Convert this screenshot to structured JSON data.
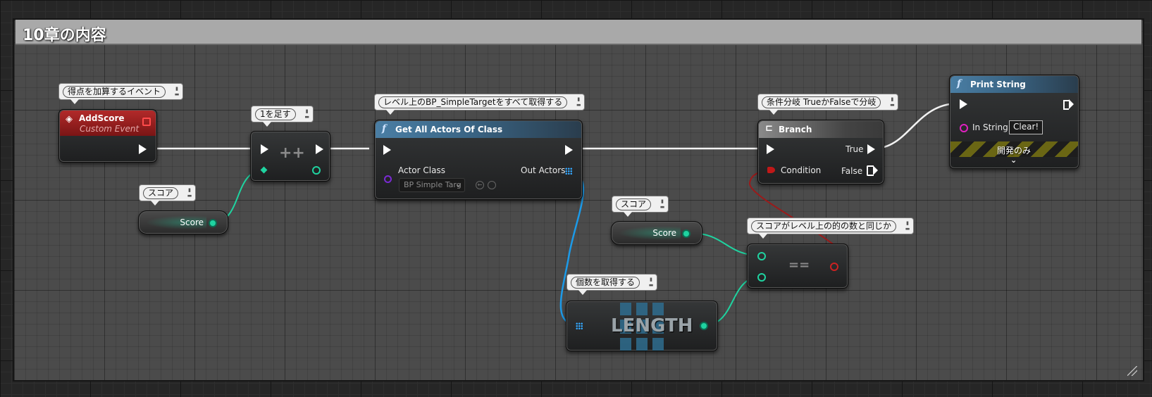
{
  "comment": {
    "title": "10章の内容"
  },
  "bubbles": {
    "add_score": "得点を加算するイベント",
    "increment": "1を足す",
    "get_all": "レベル上のBP_SimpleTargetをすべて取得する",
    "branch": "条件分岐 TrueかFalseで分岐",
    "score1": "スコア",
    "score2": "スコア",
    "equal": "スコアがレベル上の的の数と同じか",
    "length": "個数を取得する"
  },
  "nodes": {
    "add_score": {
      "title": "AddScore",
      "subtitle": "Custom Event"
    },
    "increment": {
      "symbol": "++"
    },
    "get_all": {
      "title": "Get All Actors Of Class",
      "actor_class_label": "Actor Class",
      "actor_class_value": "BP Simple Targ",
      "out_actors_label": "Out Actors"
    },
    "score_var1": {
      "label": "Score"
    },
    "score_var2": {
      "label": "Score"
    },
    "length": {
      "label": "LENGTH"
    },
    "equal": {
      "symbol": "=="
    },
    "branch": {
      "title": "Branch",
      "condition_label": "Condition",
      "true_label": "True",
      "false_label": "False"
    },
    "print_string": {
      "title": "Print String",
      "in_string_label": "In String",
      "in_string_value": "Clear!",
      "dev_label": "開発のみ"
    }
  },
  "colors": {
    "exec": "#ffffff",
    "integer": "#1fd3a0",
    "boolean": "#c01818",
    "object_array": "#33a8ff",
    "class": "#7a2ad3",
    "string": "#e020c0",
    "event_header": "#b22a2a",
    "function_header": "#4a7ea4"
  },
  "icons": [
    "event-diamond-icon",
    "function-f-icon",
    "branch-icon",
    "delegate-square-icon",
    "array-grid-icon",
    "chevron-down-icon",
    "back-arrow-icon",
    "magnifier-icon",
    "resize-grip-icon"
  ]
}
